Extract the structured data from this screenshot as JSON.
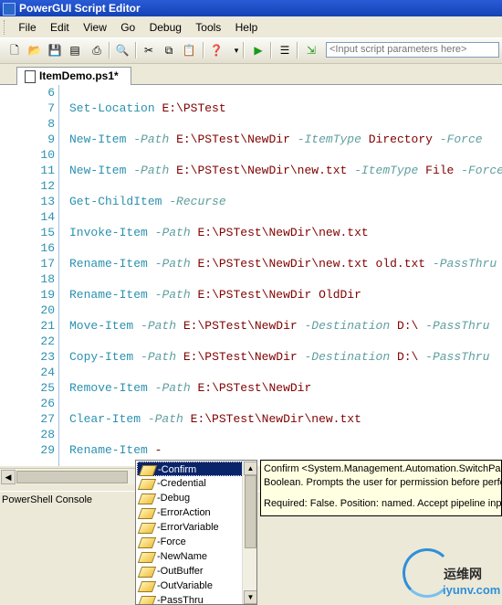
{
  "window": {
    "title": "PowerGUI Script Editor"
  },
  "menu": [
    "File",
    "Edit",
    "View",
    "Go",
    "Debug",
    "Tools",
    "Help"
  ],
  "toolbar": {
    "icons": [
      "new-file-icon",
      "open-folder-icon",
      "save-icon",
      "save-all-icon",
      "print-icon",
      "find-icon",
      "cut-icon",
      "copy-icon",
      "paste-icon",
      "help-icon",
      "run-icon",
      "run-selection-icon",
      "debug-icon"
    ],
    "params_placeholder": "<Input script parameters here>"
  },
  "tab": {
    "label": "ItemDemo.ps1*"
  },
  "code": [
    {
      "n": "6",
      "t": []
    },
    {
      "n": "7",
      "t": [
        [
          "k",
          "Set-Location"
        ],
        [
          "s",
          " "
        ],
        [
          "v",
          "E:\\PSTest"
        ]
      ]
    },
    {
      "n": "8",
      "t": []
    },
    {
      "n": "9",
      "t": [
        [
          "k",
          "New-Item"
        ],
        [
          "s",
          " "
        ],
        [
          "p",
          "-Path"
        ],
        [
          "s",
          " "
        ],
        [
          "v",
          "E:\\PSTest\\NewDir"
        ],
        [
          "s",
          " "
        ],
        [
          "p",
          "-ItemType"
        ],
        [
          "s",
          " "
        ],
        [
          "v",
          "Directory"
        ],
        [
          "s",
          " "
        ],
        [
          "p",
          "-Force"
        ]
      ]
    },
    {
      "n": "10",
      "t": []
    },
    {
      "n": "11",
      "t": [
        [
          "k",
          "New-Item"
        ],
        [
          "s",
          " "
        ],
        [
          "p",
          "-Path"
        ],
        [
          "s",
          " "
        ],
        [
          "v",
          "E:\\PSTest\\NewDir\\new.txt"
        ],
        [
          "s",
          " "
        ],
        [
          "p",
          "-ItemType"
        ],
        [
          "s",
          " "
        ],
        [
          "v",
          "File"
        ],
        [
          "s",
          " "
        ],
        [
          "p",
          "-Force"
        ]
      ]
    },
    {
      "n": "12",
      "t": []
    },
    {
      "n": "13",
      "t": [
        [
          "k",
          "Get-ChildItem"
        ],
        [
          "s",
          " "
        ],
        [
          "p",
          "-Recurse"
        ]
      ]
    },
    {
      "n": "14",
      "t": []
    },
    {
      "n": "15",
      "t": [
        [
          "k",
          "Invoke-Item"
        ],
        [
          "s",
          " "
        ],
        [
          "p",
          "-Path"
        ],
        [
          "s",
          " "
        ],
        [
          "v",
          "E:\\PSTest\\NewDir\\new.txt"
        ]
      ]
    },
    {
      "n": "16",
      "t": []
    },
    {
      "n": "17",
      "t": [
        [
          "k",
          "Rename-Item"
        ],
        [
          "s",
          " "
        ],
        [
          "p",
          "-Path"
        ],
        [
          "s",
          " "
        ],
        [
          "v",
          "E:\\PSTest\\NewDir\\new.txt old.txt"
        ],
        [
          "s",
          " "
        ],
        [
          "p",
          "-PassThru"
        ]
      ]
    },
    {
      "n": "18",
      "t": []
    },
    {
      "n": "19",
      "t": [
        [
          "k",
          "Rename-Item"
        ],
        [
          "s",
          " "
        ],
        [
          "p",
          "-Path"
        ],
        [
          "s",
          " "
        ],
        [
          "v",
          "E:\\PSTest\\NewDir OldDir"
        ]
      ]
    },
    {
      "n": "20",
      "t": []
    },
    {
      "n": "21",
      "t": [
        [
          "k",
          "Move-Item"
        ],
        [
          "s",
          " "
        ],
        [
          "p",
          "-Path"
        ],
        [
          "s",
          " "
        ],
        [
          "v",
          "E:\\PSTest\\NewDir"
        ],
        [
          "s",
          " "
        ],
        [
          "p",
          "-Destination"
        ],
        [
          "s",
          " "
        ],
        [
          "v",
          "D:\\"
        ],
        [
          "s",
          " "
        ],
        [
          "p",
          "-PassThru"
        ]
      ]
    },
    {
      "n": "22",
      "t": []
    },
    {
      "n": "23",
      "t": [
        [
          "k",
          "Copy-Item"
        ],
        [
          "s",
          " "
        ],
        [
          "p",
          "-Path"
        ],
        [
          "s",
          " "
        ],
        [
          "v",
          "E:\\PSTest\\NewDir"
        ],
        [
          "s",
          " "
        ],
        [
          "p",
          "-Destination"
        ],
        [
          "s",
          " "
        ],
        [
          "v",
          "D:\\"
        ],
        [
          "s",
          " "
        ],
        [
          "p",
          "-PassThru"
        ]
      ]
    },
    {
      "n": "24",
      "t": []
    },
    {
      "n": "25",
      "t": [
        [
          "k",
          "Remove-Item"
        ],
        [
          "s",
          " "
        ],
        [
          "p",
          "-Path"
        ],
        [
          "s",
          " "
        ],
        [
          "v",
          "E:\\PSTest\\NewDir"
        ]
      ]
    },
    {
      "n": "26",
      "t": []
    },
    {
      "n": "27",
      "t": [
        [
          "k",
          "Clear-Item"
        ],
        [
          "s",
          " "
        ],
        [
          "p",
          "-Path"
        ],
        [
          "s",
          " "
        ],
        [
          "v",
          "E:\\PSTest\\NewDir\\new.txt"
        ]
      ]
    },
    {
      "n": "28",
      "t": []
    },
    {
      "n": "29",
      "t": [
        [
          "k",
          "Rename-Item"
        ],
        [
          "s",
          " "
        ],
        [
          "v",
          "-"
        ]
      ]
    }
  ],
  "console": {
    "label": "PowerShell Console"
  },
  "autocomplete": {
    "items": [
      "-Confirm",
      "-Credential",
      "-Debug",
      "-ErrorAction",
      "-ErrorVariable",
      "-Force",
      "-NewName",
      "-OutBuffer",
      "-OutVariable",
      "-PassThru"
    ],
    "selected": "-Confirm"
  },
  "tooltip": {
    "line1": "Confirm <System.Management.Automation.SwitchParameter>",
    "line2": "Boolean. Prompts the user for permission before performing the action.",
    "line3": "Required: False. Position: named. Accept pipeline input: False."
  },
  "watermark": {
    "cn": "运维网",
    "url": "iyunv.com"
  }
}
